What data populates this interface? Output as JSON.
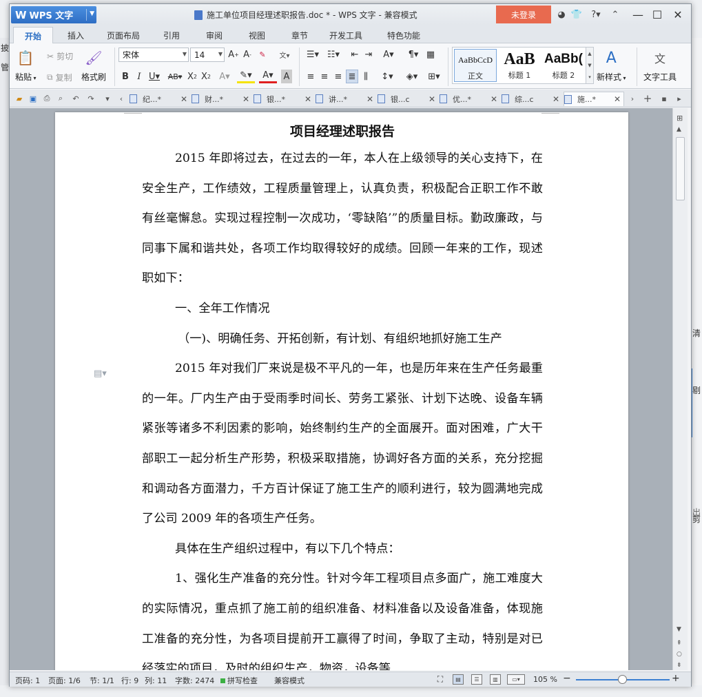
{
  "app": {
    "logo_text": "WPS 文字",
    "title": "施工单位项目经理述职报告.doc * - WPS 文字 - 兼容模式",
    "login_label": "未登录"
  },
  "menu_tabs": [
    "开始",
    "插入",
    "页面布局",
    "引用",
    "审阅",
    "视图",
    "章节",
    "开发工具",
    "特色功能"
  ],
  "ribbon": {
    "paste": "粘贴",
    "cut": "剪切",
    "copy": "复制",
    "format_painter": "格式刷",
    "font_name": "宋体",
    "font_size": "14",
    "styles": [
      {
        "sample": "AaBbCcD",
        "name": "正文"
      },
      {
        "sample": "AaB",
        "name": "标题 1"
      },
      {
        "sample": "AaBb(",
        "name": "标题 2"
      }
    ],
    "new_style": "新样式",
    "text_tools": "文字工具"
  },
  "doc_tabs": [
    "纪...*",
    "财...*",
    "银...*",
    "讲...*",
    "银...c",
    "优...*",
    "综...c",
    "施...*"
  ],
  "document": {
    "heading": "项目经理述职报告",
    "paragraphs": [
      "2015 年即将过去，在过去的一年，本人在上级领导的关心支持下，在安全生产，工作绩效，工程质量管理上，认真负责，积极配合正职工作不敢有丝毫懈怠。实现过程控制一次成功，‘零缺陷’”的质量目标。勤政廉政，与同事下属和谐共处，各项工作均取得较好的成绩。回顾一年来的工作，现述职如下：",
      "一、全年工作情况",
      "（一)、明确任务、开拓创新，有计划、有组织地抓好施工生产",
      "2015 年对我们厂来说是极不平凡的一年，也是历年来在生产任务最重的一年。厂内生产由于受雨季时间长、劳务工紧张、计划下达晚、设备车辆紧张等诸多不利因素的影响，始终制约生产的全面展开。面对困难，广大干部职工一起分析生产形势，积极采取措施，协调好各方面的关系，充分挖掘和调动各方面潜力，千方百计保证了施工生产的顺利进行，较为圆满地完成了公司 2009 年的各项生产任务。",
      "具体在生产组织过程中，有以下几个特点：",
      "1、强化生产准备的充分性。针对今年工程项目点多面广，施工难度大的实际情况，重点抓了施工前的组织准备、材料准备以及设备准备，体现施工准备的充分性，为各项目提前开工赢得了时间，争取了主动，特别是对已经落实的项目，及时的组织生产，物资，设备等"
    ]
  },
  "status": {
    "page_code": "页码: 1",
    "pages": "页面: 1/6",
    "section": "节: 1/1",
    "row": "行: 9",
    "col": "列: 11",
    "word_count": "字数: 2474",
    "spell_check": "拼写检查",
    "compat": "兼容模式",
    "zoom": "105 %"
  },
  "background_app": {
    "left_texts": [
      "披",
      "管"
    ],
    "right_texts": [
      "清",
      "剔",
      "出",
      "剪"
    ]
  },
  "colors": {
    "accent": "#2c6fc4",
    "login_bg": "#e86a4f",
    "logo_bg": "#3b7fd1"
  }
}
